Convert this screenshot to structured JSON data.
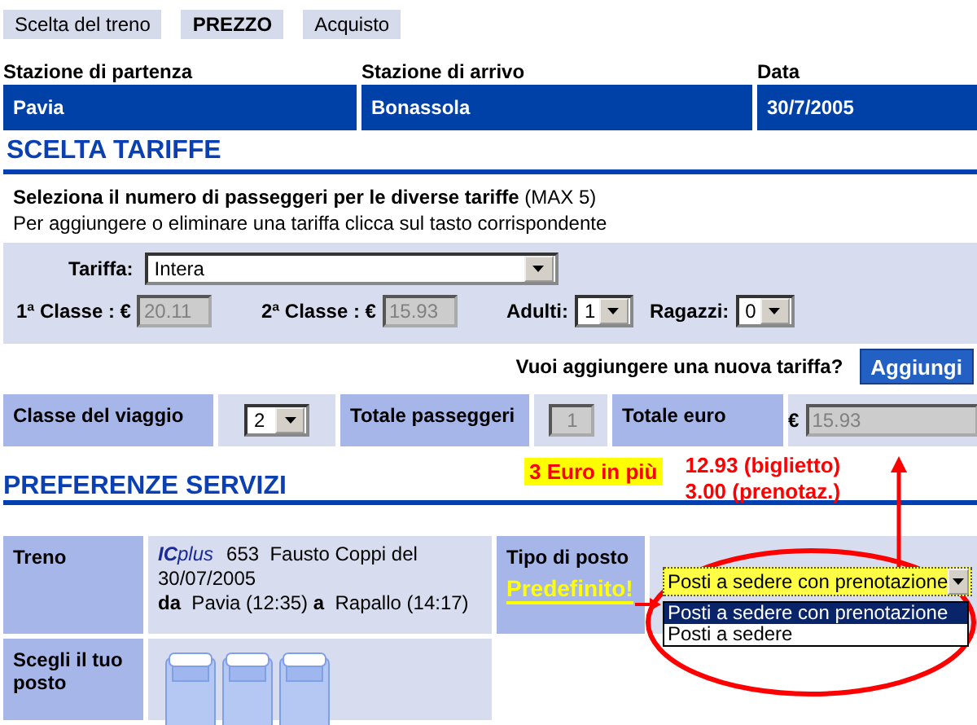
{
  "tabs": [
    {
      "label": "Scelta del treno",
      "selected": false
    },
    {
      "label": "PREZZO",
      "selected": true
    },
    {
      "label": "Acquisto",
      "selected": false
    }
  ],
  "route": {
    "columns": [
      "Stazione di partenza",
      "Stazione di arrivo",
      "Data"
    ],
    "values": [
      "Pavia",
      "Bonassola",
      "30/7/2005"
    ]
  },
  "fares": {
    "title": "SCELTA TARIFFE",
    "instruction": "**Seleziona il numero di passeggeri per le diverse tariffe** (MAX 5)",
    "hint": "Per aggiungere o eliminare una tariffa clicca sul tasto corrispondente",
    "fare": {
      "label": "Tariffa:",
      "value": "Intera"
    },
    "first_class": {
      "label": "1ª Classe : €",
      "value": "20.11",
      "disabled": true
    },
    "second_class": {
      "label": "2ª Classe : €",
      "value": "15.93",
      "disabled": true
    },
    "adults": {
      "label": "Adulti:",
      "value": "1"
    },
    "children": {
      "label": "Ragazzi:",
      "value": "0"
    },
    "add_prompt": "Vuoi aggiungere una nuova tariffa?",
    "add_button": "Aggiungi"
  },
  "totals": {
    "class_label": "Classe del viaggio",
    "class_value": "2",
    "passengers_label": "Totale passeggeri",
    "passengers_value": "1",
    "euro_label": "Totale euro",
    "currency": "€",
    "euro_value": "15.93"
  },
  "services": {
    "title": "PREFERENZE SERVIZI",
    "extra_badge": "3 Euro in più",
    "breakdown": [
      "12.93 (biglietto)",
      "3.00 (prenotaz.)"
    ],
    "train_label": "Treno",
    "logo": "**IC**plus",
    "train_lines": [
      "653  Fausto Coppi del",
      "30/07/2005",
      "**da**  Pavia (12:35) **a**  Rapallo (14:17)"
    ],
    "seat_type_label": "Tipo di posto",
    "default_note": "Predefinito!",
    "seat_type": {
      "value": "Posti a sedere con prenotazione",
      "options": [
        {
          "label": "Posti a sedere con prenotazione",
          "selected": true
        },
        {
          "label": "Posti a sedere",
          "selected": false
        }
      ]
    },
    "seat_choice_label": "Scegli il tuo posto"
  }
}
